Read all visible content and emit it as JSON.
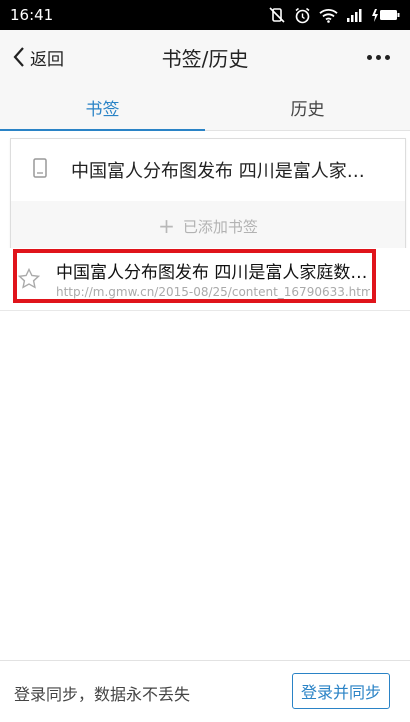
{
  "status_bar": {
    "time": "16:41"
  },
  "header": {
    "back_label": "返回",
    "title": "书签/历史"
  },
  "tabs": [
    {
      "label": "书签",
      "active": true
    },
    {
      "label": "历史",
      "active": false
    }
  ],
  "bookmark": {
    "title": "中国富人分布图发布 四川是富人家…",
    "add_label": "已添加书签"
  },
  "history": [
    {
      "title": "中国富人分布图发布 四川是富人家庭数…",
      "url": "http://m.gmw.cn/2015-08/25/content_16790633.htm"
    }
  ],
  "footer": {
    "sync_text": "登录同步，数据永不丢失",
    "login_button": "登录并同步"
  },
  "colors": {
    "accent": "#2a83c6",
    "highlight": "#e0141b"
  }
}
